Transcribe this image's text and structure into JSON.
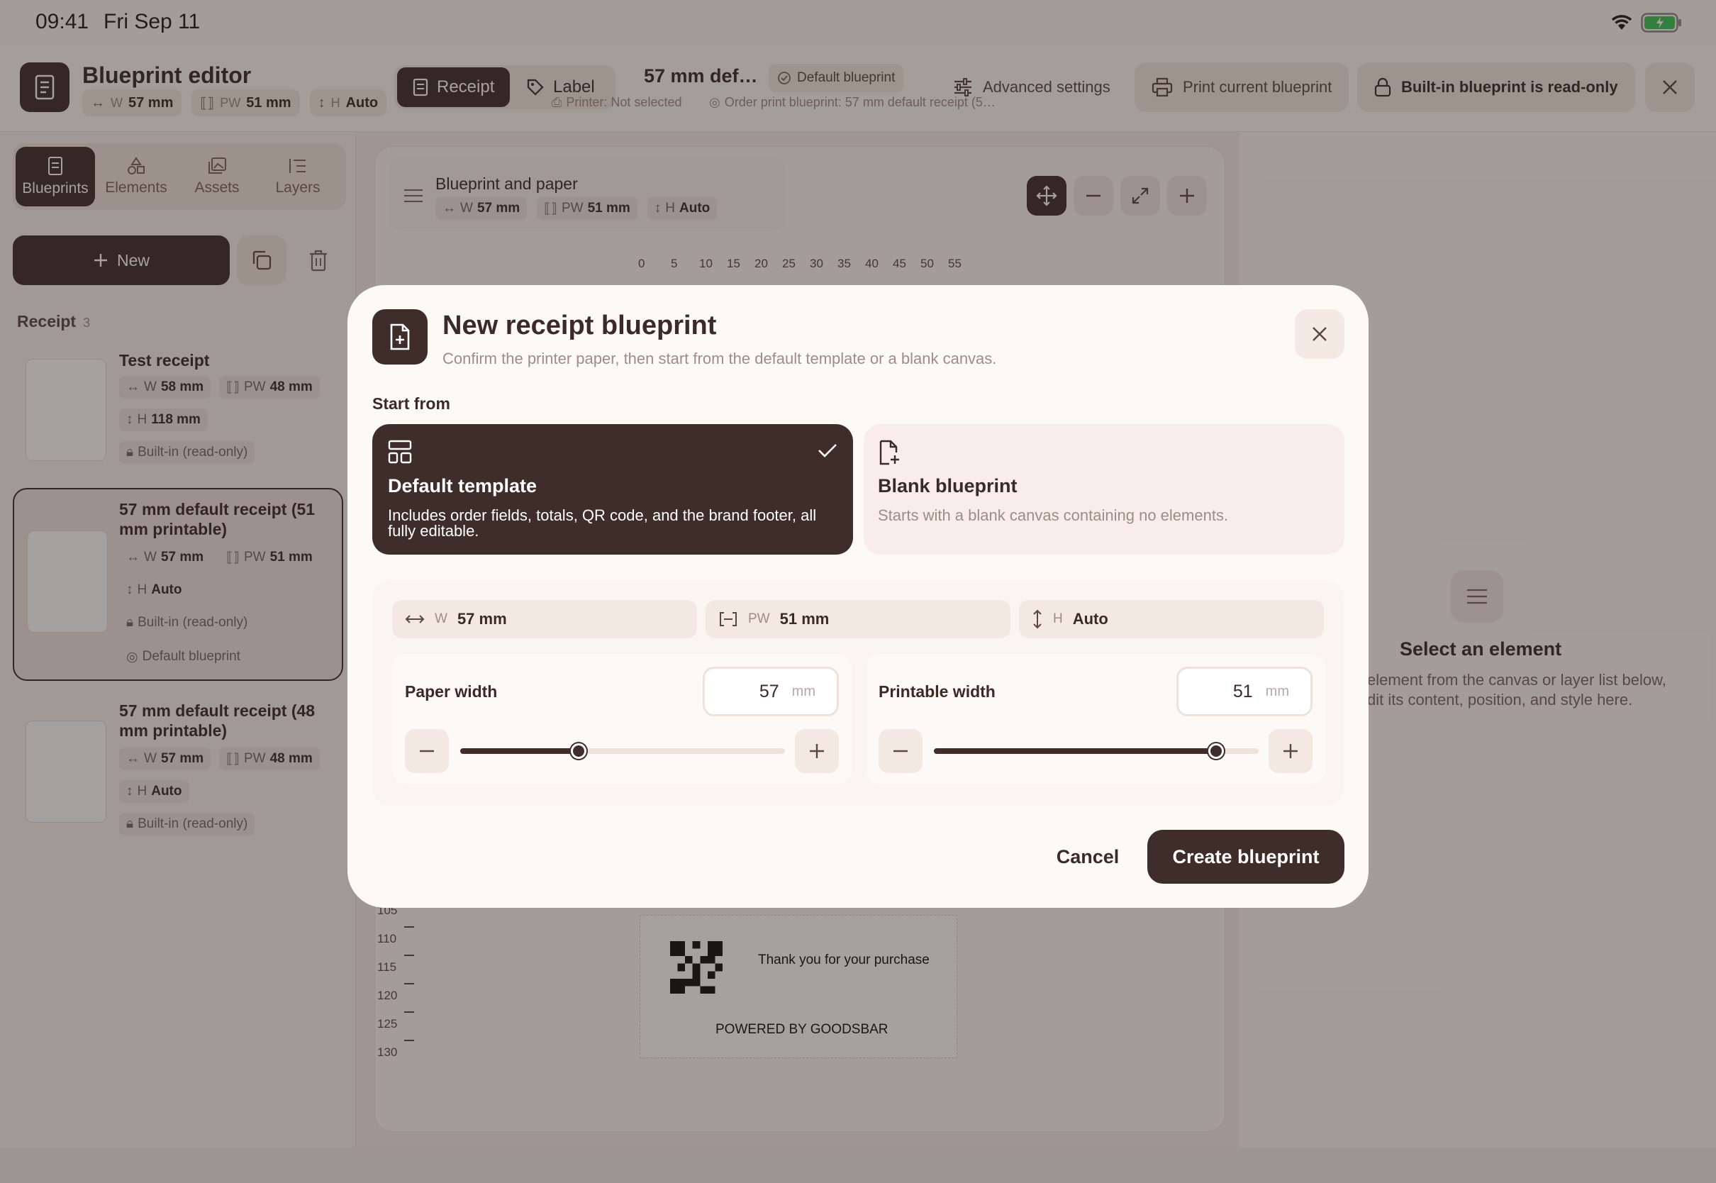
{
  "status": {
    "time": "09:41",
    "date": "Fri Sep 11"
  },
  "header": {
    "title": "Blueprint editor",
    "chips": {
      "w_label": "W",
      "w_value": "57 mm",
      "pw_label": "PW",
      "pw_value": "51 mm",
      "h_label": "H",
      "h_value": "Auto"
    },
    "mode_tabs": {
      "receipt": "Receipt",
      "label": "Label"
    },
    "blueprint_name": "57 mm def…",
    "default_badge": "Default blueprint",
    "printer_status": "Printer: Not selected",
    "order_print": "Order print blueprint: 57 mm default receipt (5…",
    "advanced": "Advanced settings",
    "print_current": "Print current blueprint",
    "readonly": "Built-in blueprint is read-only"
  },
  "left": {
    "tabs": [
      "Blueprints",
      "Elements",
      "Assets",
      "Layers"
    ],
    "new_label": "New",
    "section": {
      "title": "Receipt",
      "count": "3"
    },
    "items": [
      {
        "name": "Test receipt",
        "w": "58 mm",
        "pw": "48 mm",
        "h": "118 mm",
        "lock": "Built-in (read-only)"
      },
      {
        "name": "57 mm default receipt (51 mm printable)",
        "w": "57 mm",
        "pw": "51 mm",
        "h": "Auto",
        "lock": "Built-in (read-only)",
        "badge": "Default blueprint"
      },
      {
        "name": "57 mm default receipt (48 mm printable)",
        "w": "57 mm",
        "pw": "48 mm",
        "h": "Auto",
        "lock": "Built-in (read-only)"
      }
    ]
  },
  "canvas": {
    "panel_title": "Blueprint and paper",
    "ruler_top": [
      "0",
      "5",
      "10",
      "15",
      "20",
      "25",
      "30",
      "35",
      "40",
      "45",
      "50",
      "55"
    ],
    "ruler_left": [
      "105",
      "110",
      "115",
      "120",
      "125",
      "130"
    ],
    "thank_you": "Thank you for your purchase",
    "powered_by": "POWERED BY GOODSBAR"
  },
  "inspector": {
    "title": "Select an element",
    "desc1": "element from the canvas or layer list below,",
    "desc2": "dit its content, position, and style here."
  },
  "modal": {
    "title": "New receipt blueprint",
    "subtitle": "Confirm the printer paper, then start from the default template or a blank canvas.",
    "start_from": "Start from",
    "options": {
      "default": {
        "title": "Default template",
        "desc_line1": "Includes order fields, totals, QR code, and the brand footer, all",
        "desc_line2": "fully editable."
      },
      "blank": {
        "title": "Blank blueprint",
        "desc": "Starts with a blank canvas containing no elements."
      }
    },
    "dims": {
      "w_label": "W",
      "w_value": "57 mm",
      "pw_label": "PW",
      "pw_value": "51 mm",
      "h_label": "H",
      "h_value": "Auto"
    },
    "paper_width": {
      "label": "Paper width",
      "value": "57",
      "unit": "mm",
      "fraction": 0.364
    },
    "printable_width": {
      "label": "Printable width",
      "value": "51",
      "unit": "mm",
      "fraction": 0.869
    },
    "cancel": "Cancel",
    "create": "Create blueprint"
  }
}
